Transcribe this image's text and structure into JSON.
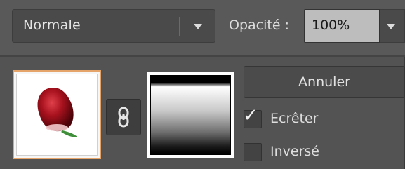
{
  "blend": {
    "mode": "Normale"
  },
  "opacity": {
    "label": "Opacité :",
    "value": "100%"
  },
  "buttons": {
    "cancel": "Annuler"
  },
  "options": {
    "clip": {
      "label": "Ecrêter",
      "checked": true
    },
    "invert": {
      "label": "Inversé",
      "checked": false
    }
  },
  "icons": {
    "dropdown": "chevron-down-icon",
    "link": "chain-link-icon",
    "check": "checkmark-icon"
  },
  "colors": {
    "panel_bg": "#535353",
    "selected_thumb_border": "#e4a46a",
    "opacity_field_bg": "#bdbdbd"
  }
}
